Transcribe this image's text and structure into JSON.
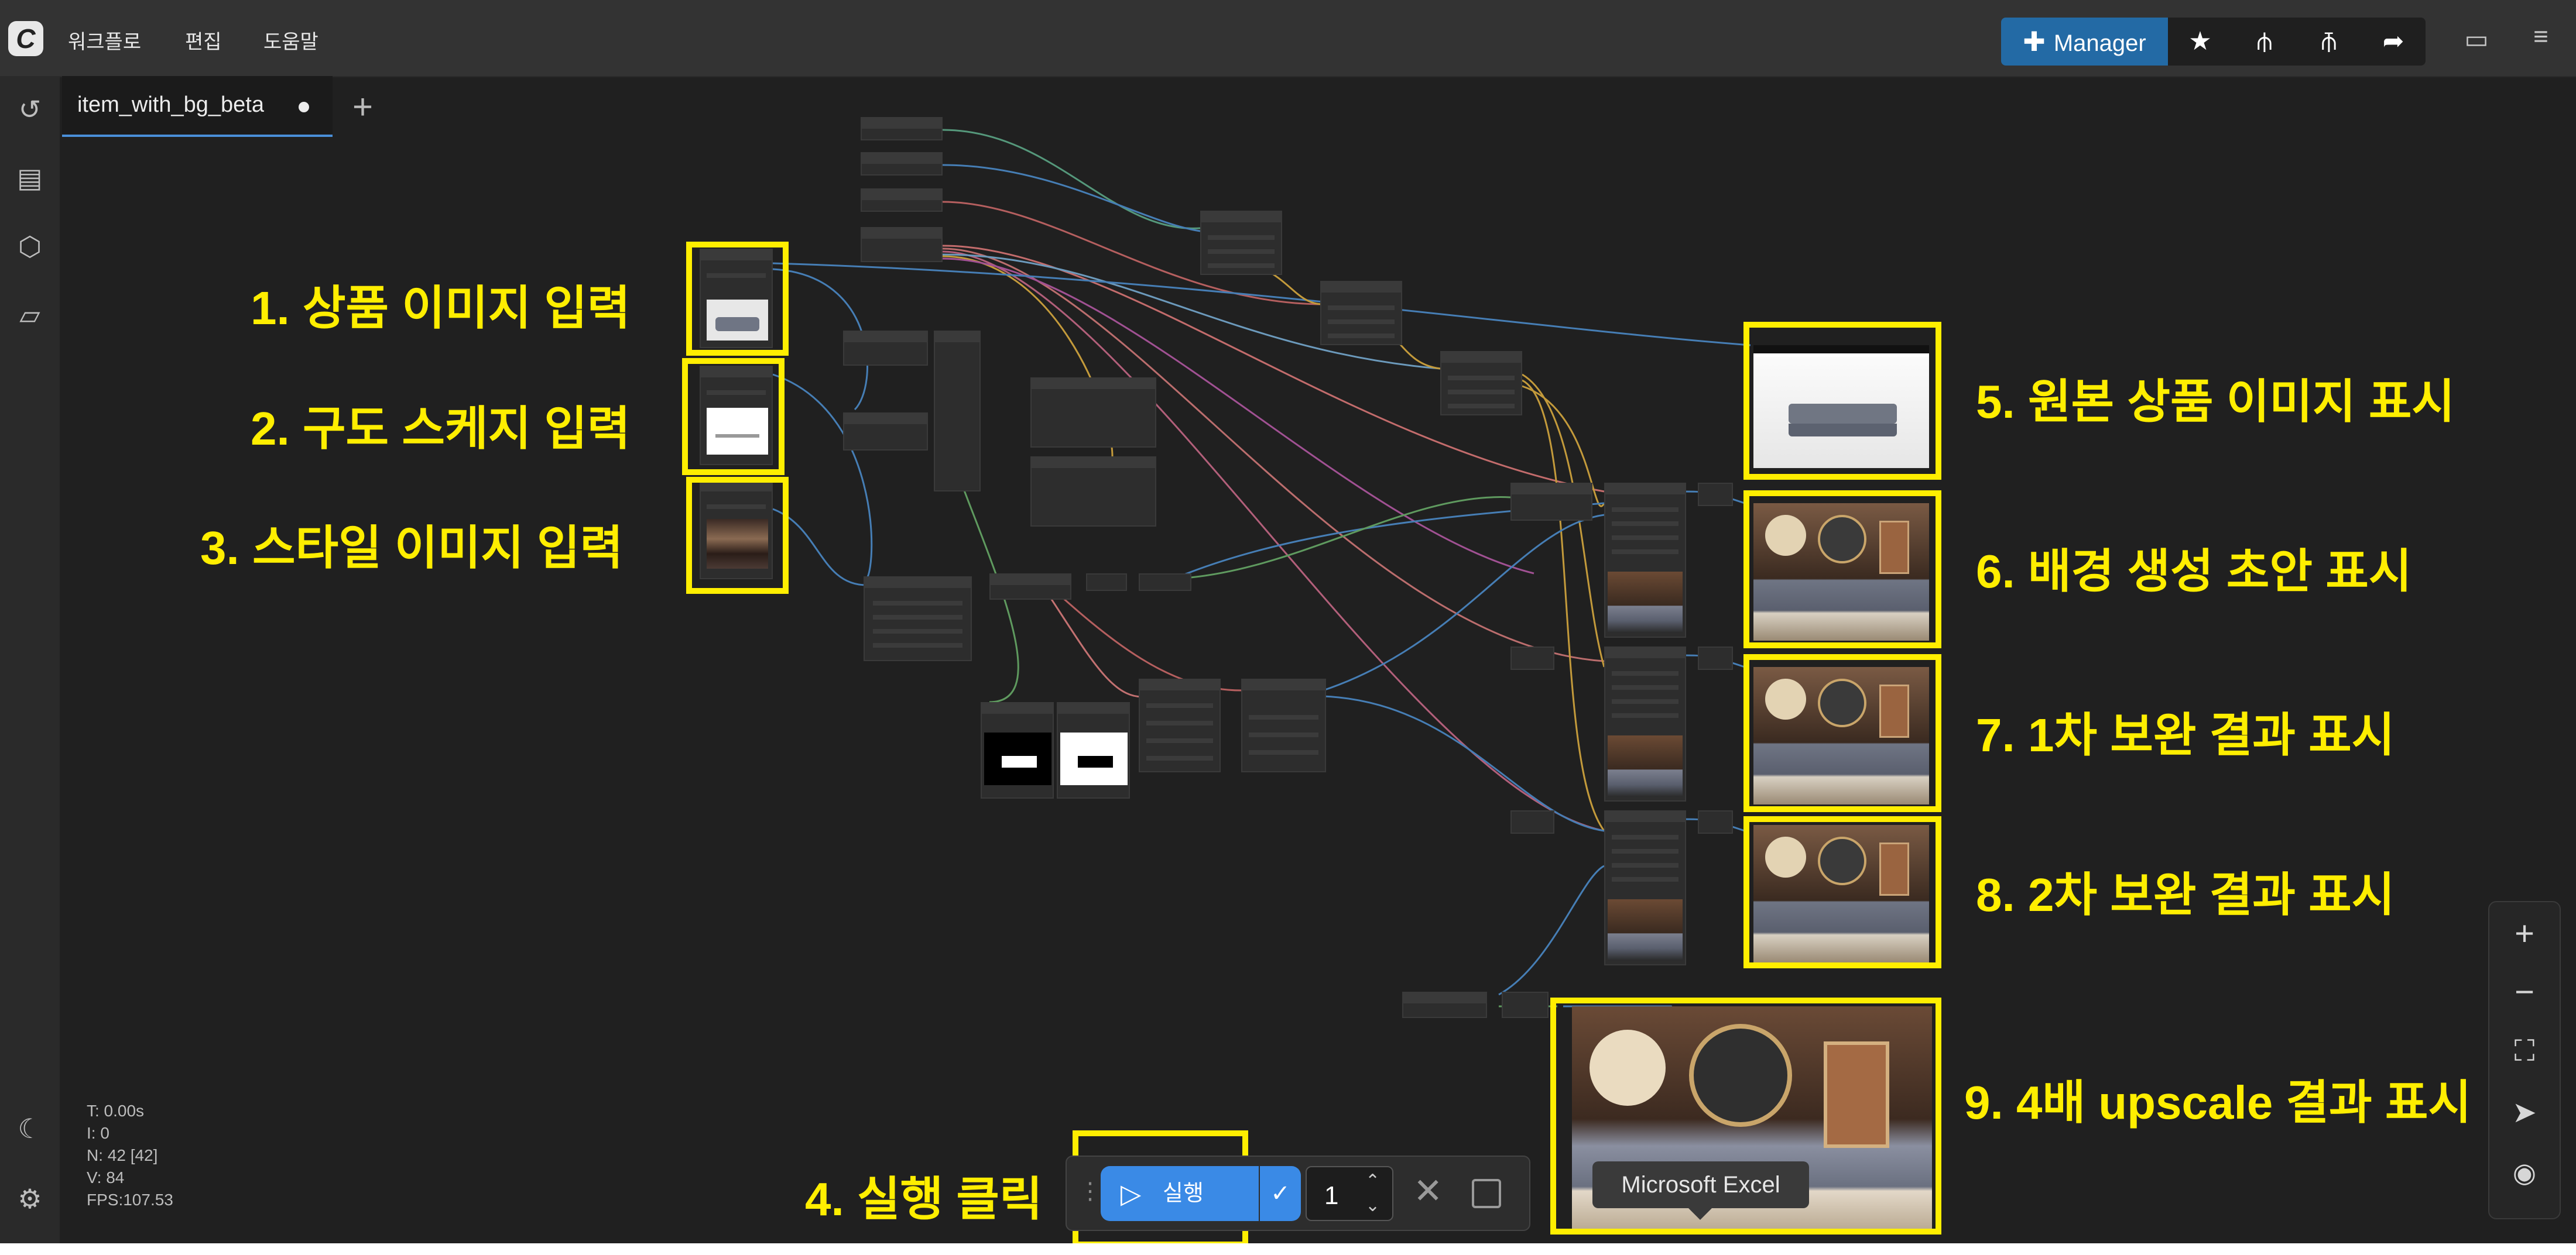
{
  "topbar": {
    "logo": "C",
    "menu": [
      "워크플로",
      "편집",
      "도움말"
    ],
    "manager_label": "Manager"
  },
  "tab": {
    "title": "item_with_bg_beta",
    "new_tab": "+"
  },
  "annotations": [
    "1. 상품 이미지 입력",
    "2. 구도 스케지 입력",
    "3. 스타일 이미지 입력",
    "4. 실행 클릭",
    "5. 원본 상품 이미지 표시",
    "6. 배경 생성 초안 표시",
    "7. 1차 보완 결과 표시",
    "8. 2차 보완 결과 표시",
    "9. 4배 upscale 결과 표시"
  ],
  "stats": {
    "t": "T: 0.00s",
    "i": "I: 0",
    "n": "N: 42 [42]",
    "v": "V: 84",
    "fps": "FPS:107.53"
  },
  "run": {
    "label": "실행",
    "quantity": "1"
  },
  "tooltip": "Microsoft Excel",
  "colors": {
    "accent": "#ffee00",
    "run_button": "#3a8ae6",
    "manager": "#236aa5"
  }
}
